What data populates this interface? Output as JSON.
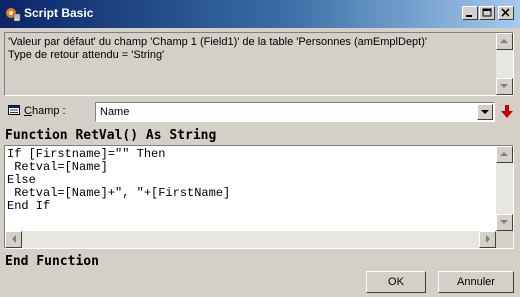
{
  "window": {
    "title": "Script Basic"
  },
  "description": {
    "line1": "'Valeur par défaut' du champ 'Champ 1 (Field1)' de la table 'Personnes (amEmplDept)'",
    "line2": "Type de retour attendu = 'String'"
  },
  "champ": {
    "label_underlined": "C",
    "label_rest": "hamp :",
    "value": "Name"
  },
  "function": {
    "header": "Function RetVal() As String",
    "footer": "End Function",
    "code": "If [Firstname]=\"\" Then\n Retval=[Name]\nElse\n Retval=[Name]+\", \"+[FirstName]\nEnd If"
  },
  "buttons": {
    "ok": "OK",
    "cancel": "Annuler"
  },
  "icons": {
    "app": "script-app-icon",
    "field": "field-icon",
    "insert": "red-down-arrow-icon"
  },
  "colors": {
    "titlebar_start": "#0a246a",
    "titlebar_end": "#a6caf0",
    "insert_arrow": "#cc0000"
  }
}
